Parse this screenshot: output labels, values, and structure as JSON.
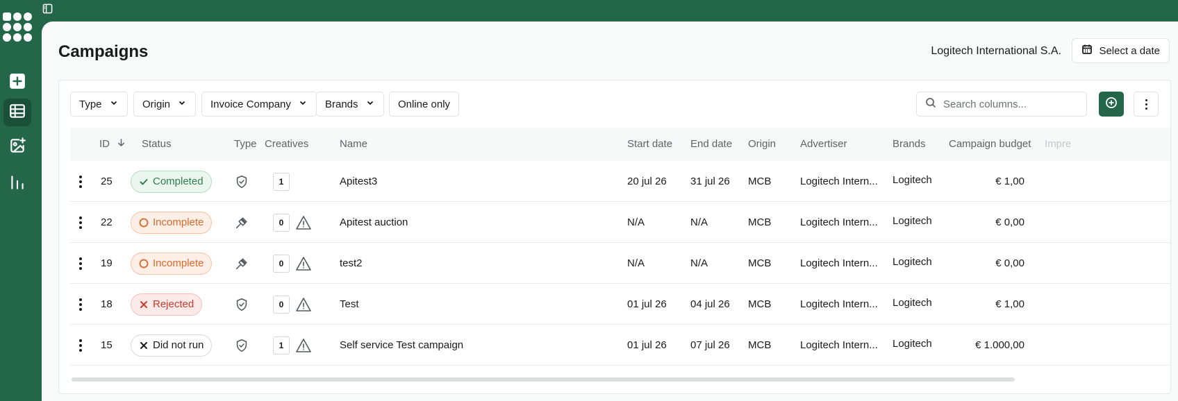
{
  "sidebar": {
    "items": [
      {
        "name": "create",
        "icon": "plus-square-icon",
        "active": false
      },
      {
        "name": "campaigns",
        "icon": "table-icon",
        "active": true
      },
      {
        "name": "creatives",
        "icon": "image-plus-icon",
        "active": false
      },
      {
        "name": "reports",
        "icon": "bar-chart-icon",
        "active": false
      }
    ]
  },
  "header": {
    "title": "Campaigns",
    "company": "Logitech International S.A.",
    "date_button": "Select a date"
  },
  "filters": {
    "type": "Type",
    "origin": "Origin",
    "invoice_company": "Invoice Company",
    "brands": "Brands",
    "online_only": "Online only"
  },
  "search": {
    "placeholder": "Search columns..."
  },
  "columns": {
    "id": "ID",
    "status": "Status",
    "type": "Type",
    "creatives": "Creatives",
    "name": "Name",
    "start_date": "Start date",
    "end_date": "End date",
    "origin": "Origin",
    "advertiser": "Advertiser",
    "brands": "Brands",
    "budget": "Campaign budget",
    "impressions": "Impre"
  },
  "rows": [
    {
      "id": "25",
      "status": "Completed",
      "status_kind": "completed",
      "type_icon": "shield-check-icon",
      "creatives": "1",
      "warning": false,
      "name": "Apitest3",
      "start": "20 jul 26",
      "end": "31 jul 26",
      "origin": "MCB",
      "advertiser": "Logitech Intern...",
      "brands": "Logitech",
      "budget": "€ 1,00"
    },
    {
      "id": "22",
      "status": "Incomplete",
      "status_kind": "incomplete",
      "type_icon": "gavel-icon",
      "creatives": "0",
      "warning": true,
      "name": "Apitest auction",
      "start": "N/A",
      "end": "N/A",
      "origin": "MCB",
      "advertiser": "Logitech Intern...",
      "brands": "Logitech",
      "budget": "€ 0,00"
    },
    {
      "id": "19",
      "status": "Incomplete",
      "status_kind": "incomplete",
      "type_icon": "gavel-icon",
      "creatives": "0",
      "warning": true,
      "name": "test2",
      "start": "N/A",
      "end": "N/A",
      "origin": "MCB",
      "advertiser": "Logitech Intern...",
      "brands": "Logitech",
      "budget": "€ 0,00"
    },
    {
      "id": "18",
      "status": "Rejected",
      "status_kind": "rejected",
      "type_icon": "shield-check-icon",
      "creatives": "0",
      "warning": true,
      "name": "Test",
      "start": "01 jul 26",
      "end": "04 jul 26",
      "origin": "MCB",
      "advertiser": "Logitech Intern...",
      "brands": "Logitech",
      "budget": "€ 1,00"
    },
    {
      "id": "15",
      "status": "Did not run",
      "status_kind": "didnotrun",
      "type_icon": "shield-check-icon",
      "creatives": "1",
      "warning": true,
      "name": "Self service Test campaign",
      "start": "01 jul 26",
      "end": "07 jul 26",
      "origin": "MCB",
      "advertiser": "Logitech Intern...",
      "brands": "Logitech",
      "budget": "€ 1.000,00"
    }
  ],
  "colors": {
    "brand": "#236649",
    "completed": "#2f7d4f",
    "incomplete": "#d96a2b",
    "rejected": "#c63b2e"
  }
}
